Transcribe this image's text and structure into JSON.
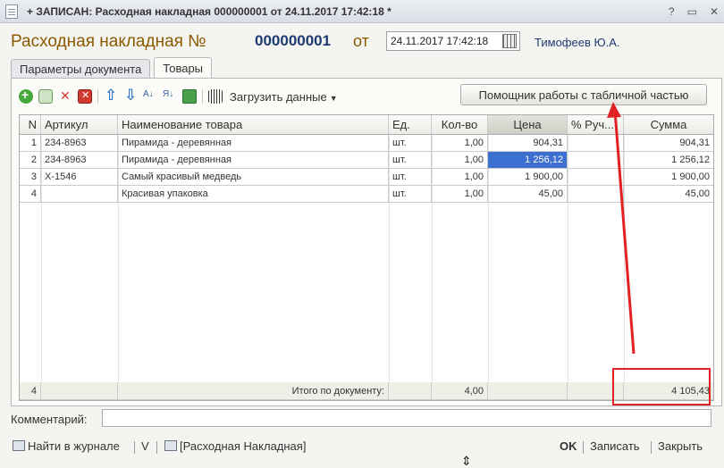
{
  "window": {
    "title": "+ ЗАПИСАН: Расходная накладная 000000001 от 24.11.2017 17:42:18 *",
    "controls": [
      "?",
      "▭",
      "✕"
    ]
  },
  "header": {
    "doc_title": "Расходная накладная №",
    "doc_number": "000000001",
    "ot_label": "от",
    "date_value": "24.11.2017 17:42:18",
    "user": "Тимофеев Ю.А."
  },
  "tabs": [
    {
      "label": "Параметры документа",
      "active": false
    },
    {
      "label": "Товары",
      "active": true
    }
  ],
  "toolbar": {
    "icons": [
      "add-icon",
      "copy-icon",
      "delete-icon",
      "mark-delete-icon",
      "move-up-icon",
      "move-down-icon",
      "sort-asc-icon",
      "sort-desc-icon",
      "scale-icon",
      "barcode-icon"
    ],
    "load_label": "Загрузить данные",
    "helper_label": "Помощник работы с табличной частью"
  },
  "table": {
    "headers": [
      "N",
      "Артикул",
      "Наименование товара",
      "Ед.",
      "Кол-во",
      "Цена",
      "% Руч...",
      "Сумма"
    ],
    "rows": [
      {
        "n": "1",
        "article": "234-8963",
        "name": "Пирамида - деревянная",
        "unit": "шт.",
        "qty": "1,00",
        "price": "904,31",
        "manual": "",
        "sum": "904,31"
      },
      {
        "n": "2",
        "article": "234-8963",
        "name": "Пирамида - деревянная",
        "unit": "шт.",
        "qty": "1,00",
        "price": "1 256,12",
        "manual": "",
        "sum": "1 256,12"
      },
      {
        "n": "3",
        "article": "X-1546",
        "name": "Самый красивый медведь",
        "unit": "шт.",
        "qty": "1,00",
        "price": "1 900,00",
        "manual": "",
        "sum": "1 900,00"
      },
      {
        "n": "4",
        "article": "",
        "name": "Красивая упаковка",
        "unit": "шт.",
        "qty": "1,00",
        "price": "45,00",
        "manual": "",
        "sum": "45,00"
      }
    ],
    "footer": {
      "count": "4",
      "total_label": "Итого по документу:",
      "qty_total": "4,00",
      "sum_total": "4 105,43"
    }
  },
  "comment": {
    "label": "Комментарий:",
    "value": ""
  },
  "bottom": {
    "journal_label": "Найти в журнале",
    "v_label": "V",
    "print_label": "[Расходная Накладная]",
    "ok_label": "OK",
    "save_label": "Записать",
    "close_label": "Закрыть"
  },
  "annotation_color": "#e12222"
}
